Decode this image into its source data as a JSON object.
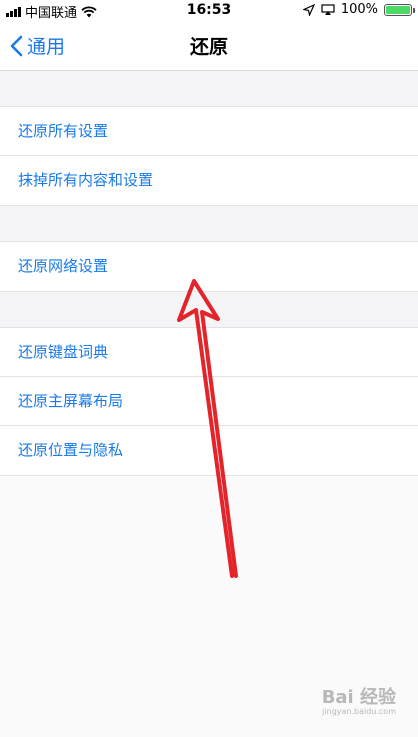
{
  "status_bar": {
    "carrier": "中国联通",
    "time": "16:53",
    "battery": "100%"
  },
  "nav": {
    "back_label": "通用",
    "title": "还原"
  },
  "groups": [
    {
      "items": [
        "还原所有设置",
        "抹掉所有内容和设置"
      ]
    },
    {
      "items": [
        "还原网络设置"
      ]
    },
    {
      "items": [
        "还原键盘词典",
        "还原主屏幕布局",
        "还原位置与隐私"
      ]
    }
  ],
  "watermark": {
    "brand": "Bai 经验",
    "url": "jingyan.baidu.com"
  },
  "colors": {
    "accent": "#1a7ae8",
    "arrow": "#e3242b",
    "battery": "#4cd964"
  }
}
